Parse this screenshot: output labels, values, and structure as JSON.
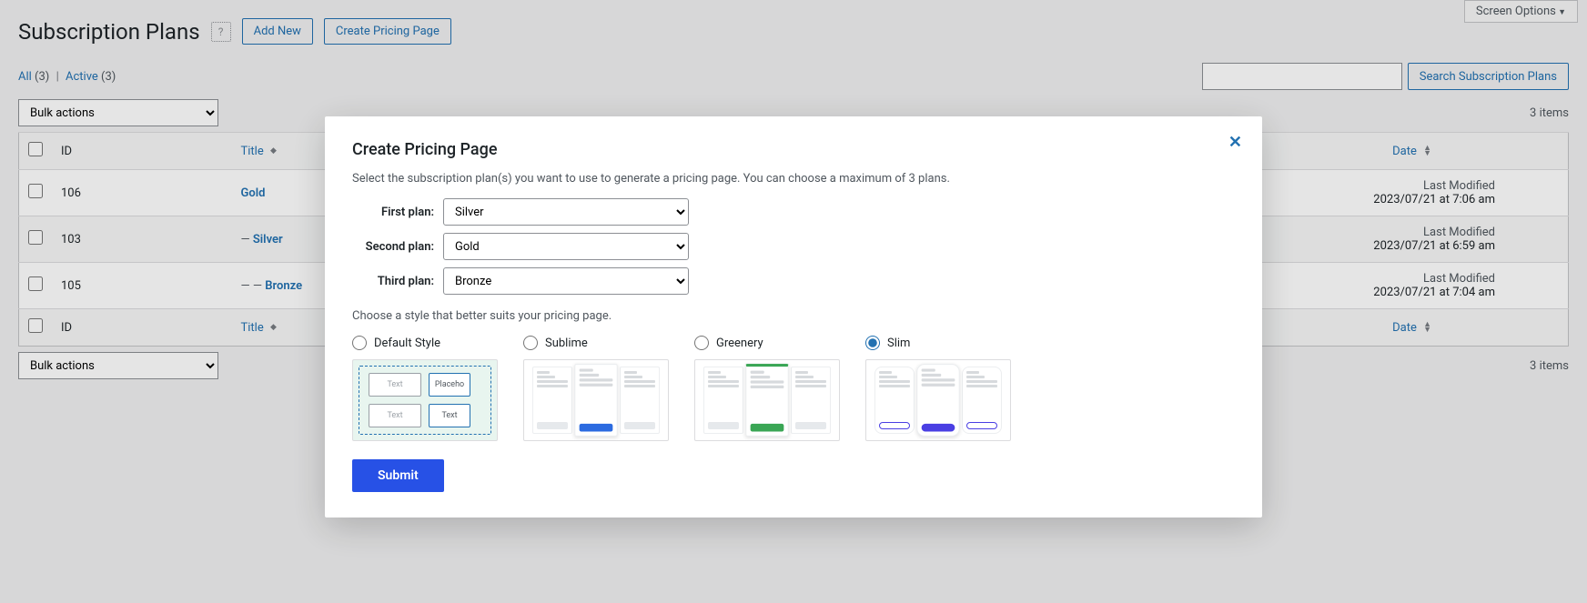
{
  "screenOptions": "Screen Options",
  "header": {
    "title": "Subscription Plans",
    "help": "?",
    "addNew": "Add New",
    "createPricing": "Create Pricing Page"
  },
  "filters": {
    "all_label": "All",
    "all_count": "(3)",
    "active_label": "Active",
    "active_count": "(3)"
  },
  "search": {
    "button": "Search Subscription Plans"
  },
  "bulk": {
    "label": "Bulk actions"
  },
  "count": "3 items",
  "cols": {
    "id": "ID",
    "title": "Title",
    "date": "Date"
  },
  "rows": [
    {
      "id": "106",
      "title": "Gold",
      "prefix": "",
      "lm": "Last Modified",
      "dt": "2023/07/21 at 7:06 am"
    },
    {
      "id": "103",
      "title": "Silver",
      "prefix": "— ",
      "lm": "Last Modified",
      "dt": "2023/07/21 at 6:59 am"
    },
    {
      "id": "105",
      "title": "Bronze",
      "prefix": "— — ",
      "lm": "Last Modified",
      "dt": "2023/07/21 at 7:04 am"
    }
  ],
  "modal": {
    "title": "Create Pricing Page",
    "intro": "Select the subscription plan(s) you want to use to generate a pricing page. You can choose a maximum of 3 plans.",
    "plan1_label": "First plan:",
    "plan2_label": "Second plan:",
    "plan3_label": "Third plan:",
    "plan1_value": "Silver",
    "plan2_value": "Gold",
    "plan3_value": "Bronze",
    "style_intro": "Choose a style that better suits your pricing page.",
    "styles": {
      "default": "Default Style",
      "sublime": "Sublime",
      "greenery": "Greenery",
      "slim": "Slim"
    },
    "selected_style": "slim",
    "thumb_text": "Text",
    "thumb_placeholder": "Placeho",
    "submit": "Submit"
  }
}
